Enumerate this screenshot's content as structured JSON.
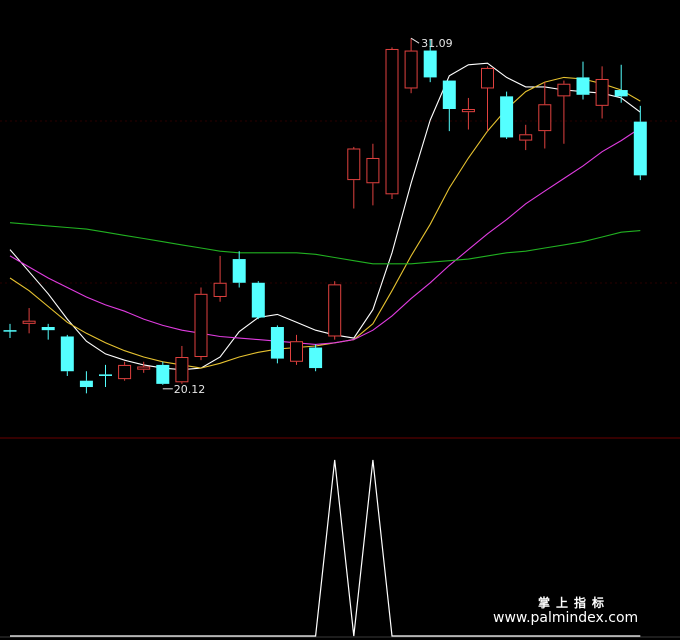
{
  "chart_data": {
    "type": "candlestick",
    "price_range": [
      18.5,
      32.3
    ],
    "colors": {
      "up": "#e0413f",
      "down": "#54ffff",
      "ma5": "#ffffff",
      "ma10": "#e6c230",
      "ma20": "#e03ce0",
      "ma60": "#21b121",
      "indicator": "#ffffff",
      "separator": "#6a0000"
    },
    "candles": [
      {
        "o": 21.85,
        "c": 21.85,
        "h": 22.05,
        "l": 21.6
      },
      {
        "o": 22.05,
        "c": 22.15,
        "h": 22.55,
        "l": 21.75
      },
      {
        "o": 21.95,
        "c": 21.85,
        "h": 22.05,
        "l": 21.55
      },
      {
        "o": 21.65,
        "c": 20.55,
        "h": 21.7,
        "l": 20.4
      },
      {
        "o": 20.25,
        "c": 20.05,
        "h": 20.55,
        "l": 19.85
      },
      {
        "o": 20.45,
        "c": 20.4,
        "h": 20.75,
        "l": 20.05
      },
      {
        "o": 20.3,
        "c": 20.75,
        "h": 20.85,
        "l": 20.25
      },
      {
        "o": 20.6,
        "c": 20.7,
        "h": 20.85,
        "l": 20.5
      },
      {
        "o": 20.75,
        "c": 20.15,
        "h": 20.85,
        "l": 20.12
      },
      {
        "o": 20.2,
        "c": 21.0,
        "h": 21.35,
        "l": 20.15
      },
      {
        "o": 21.0,
        "c": 23.0,
        "h": 23.2,
        "l": 20.9
      },
      {
        "o": 22.9,
        "c": 23.35,
        "h": 24.2,
        "l": 22.75
      },
      {
        "o": 24.1,
        "c": 23.35,
        "h": 24.35,
        "l": 23.2
      },
      {
        "o": 23.35,
        "c": 22.25,
        "h": 23.4,
        "l": 22.2
      },
      {
        "o": 21.95,
        "c": 20.95,
        "h": 22.0,
        "l": 20.8
      },
      {
        "o": 20.85,
        "c": 21.5,
        "h": 21.7,
        "l": 20.75
      },
      {
        "o": 21.3,
        "c": 20.65,
        "h": 21.4,
        "l": 20.55
      },
      {
        "o": 21.65,
        "c": 23.3,
        "h": 23.4,
        "l": 21.55
      },
      {
        "o": 26.6,
        "c": 27.6,
        "h": 27.65,
        "l": 25.7
      },
      {
        "o": 26.5,
        "c": 27.3,
        "h": 27.75,
        "l": 25.8
      },
      {
        "o": 26.15,
        "c": 30.75,
        "h": 30.8,
        "l": 26.0
      },
      {
        "o": 29.5,
        "c": 30.7,
        "h": 31.09,
        "l": 29.35
      },
      {
        "o": 30.7,
        "c": 29.85,
        "h": 31.05,
        "l": 29.7
      },
      {
        "o": 29.75,
        "c": 28.85,
        "h": 29.75,
        "l": 28.15
      },
      {
        "o": 28.75,
        "c": 28.85,
        "h": 29.2,
        "l": 28.2
      },
      {
        "o": 29.5,
        "c": 30.15,
        "h": 30.2,
        "l": 28.15
      },
      {
        "o": 29.25,
        "c": 27.95,
        "h": 29.4,
        "l": 27.9
      },
      {
        "o": 27.85,
        "c": 28.05,
        "h": 28.35,
        "l": 27.55
      },
      {
        "o": 28.15,
        "c": 29.0,
        "h": 29.7,
        "l": 27.6
      },
      {
        "o": 29.25,
        "c": 29.65,
        "h": 29.75,
        "l": 27.75
      },
      {
        "o": 29.85,
        "c": 29.3,
        "h": 30.35,
        "l": 29.15
      },
      {
        "o": 28.95,
        "c": 29.8,
        "h": 30.2,
        "l": 28.55
      },
      {
        "o": 29.45,
        "c": 29.25,
        "h": 30.25,
        "l": 29.05
      },
      {
        "o": 28.45,
        "c": 26.75,
        "h": 28.95,
        "l": 26.6
      }
    ],
    "ma_lines": [
      {
        "name": "MA5",
        "values": [
          24.4,
          23.7,
          23.0,
          22.2,
          21.5,
          21.1,
          20.9,
          20.75,
          20.65,
          20.6,
          20.65,
          21.0,
          21.8,
          22.25,
          22.35,
          22.1,
          21.85,
          21.7,
          21.6,
          22.5,
          24.3,
          26.5,
          28.5,
          29.9,
          30.25,
          30.3,
          29.85,
          29.55,
          29.55,
          29.45,
          29.4,
          29.35,
          29.2,
          28.75
        ]
      },
      {
        "name": "MA10",
        "values": [
          23.5,
          23.1,
          22.6,
          22.1,
          21.75,
          21.45,
          21.2,
          21.0,
          20.85,
          20.75,
          20.65,
          20.8,
          21.0,
          21.15,
          21.25,
          21.3,
          21.35,
          21.45,
          21.55,
          22.05,
          23.1,
          24.2,
          25.2,
          26.35,
          27.3,
          28.15,
          28.85,
          29.4,
          29.7,
          29.85,
          29.8,
          29.65,
          29.45,
          29.1
        ]
      },
      {
        "name": "MA20",
        "values": [
          24.2,
          23.85,
          23.5,
          23.2,
          22.9,
          22.65,
          22.45,
          22.2,
          22.0,
          21.85,
          21.75,
          21.65,
          21.6,
          21.55,
          21.5,
          21.45,
          21.4,
          21.45,
          21.55,
          21.85,
          22.3,
          22.85,
          23.35,
          23.9,
          24.4,
          24.9,
          25.35,
          25.85,
          26.25,
          26.65,
          27.05,
          27.5,
          27.85,
          28.25
        ]
      },
      {
        "name": "MA60",
        "values": [
          25.25,
          25.2,
          25.15,
          25.1,
          25.05,
          24.95,
          24.85,
          24.75,
          24.65,
          24.55,
          24.45,
          24.35,
          24.3,
          24.3,
          24.3,
          24.3,
          24.25,
          24.15,
          24.05,
          23.95,
          23.95,
          23.95,
          24.0,
          24.05,
          24.1,
          24.2,
          24.3,
          24.35,
          24.45,
          24.55,
          24.65,
          24.8,
          24.95,
          25.0
        ]
      }
    ],
    "indicator": {
      "range": [
        0,
        1
      ],
      "values": [
        0,
        0,
        0,
        0,
        0,
        0,
        0,
        0,
        0,
        0,
        0,
        0,
        0,
        0,
        0,
        0,
        0,
        1,
        0,
        1,
        0,
        0,
        0,
        0,
        0,
        0,
        0,
        0,
        0,
        0,
        0,
        0,
        0,
        0
      ]
    },
    "annotations": [
      {
        "text": "31.09",
        "candle": 21,
        "at": "high"
      },
      {
        "text": "20.12",
        "candle": 8,
        "at": "low"
      }
    ]
  },
  "watermark": {
    "line1": "掌上指标",
    "line2": "www.palmindex.com"
  }
}
